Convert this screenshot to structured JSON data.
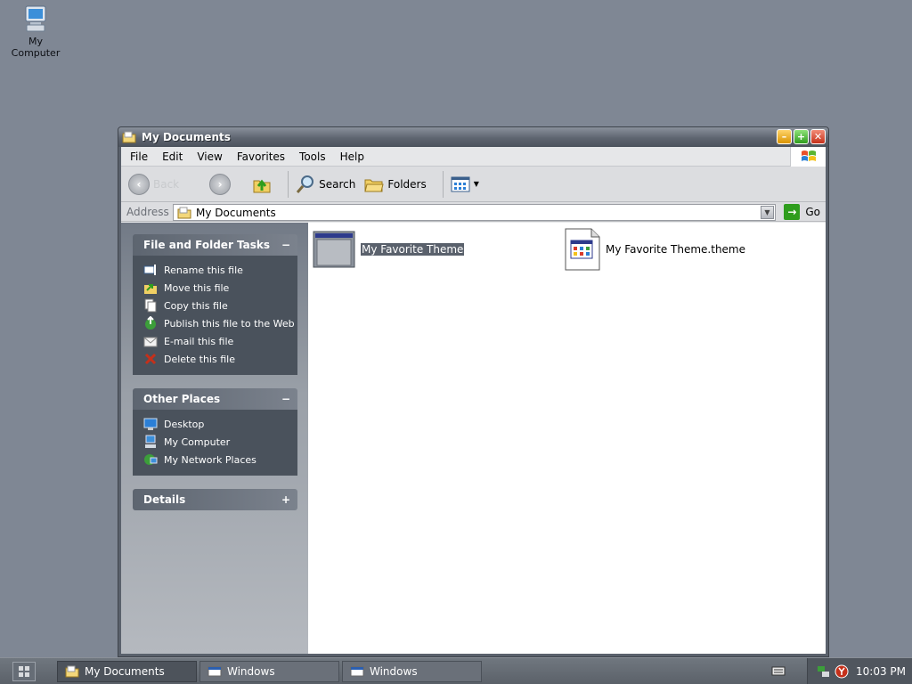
{
  "desktop": {
    "icons": [
      {
        "label": "My Computer"
      }
    ]
  },
  "window": {
    "title": "My Documents",
    "menu": [
      "File",
      "Edit",
      "View",
      "Favorites",
      "Tools",
      "Help"
    ],
    "toolbar": {
      "back_label": "Back",
      "search_label": "Search",
      "folders_label": "Folders"
    },
    "address": {
      "label": "Address",
      "value": "My Documents",
      "go_label": "Go"
    },
    "task_pane": {
      "file_tasks": {
        "title": "File and Folder Tasks",
        "toggle": "−",
        "items": [
          "Rename this file",
          "Move this file",
          "Copy this file",
          "Publish this file to the Web",
          "E-mail this file",
          "Delete this file"
        ]
      },
      "other_places": {
        "title": "Other Places",
        "toggle": "−",
        "items": [
          "Desktop",
          "My Computer",
          "My Network Places"
        ]
      },
      "details": {
        "title": "Details",
        "toggle": "+"
      }
    },
    "files": [
      {
        "name": "My Favorite Theme",
        "selected": true
      },
      {
        "name": "My Favorite Theme.theme",
        "selected": false
      }
    ]
  },
  "taskbar": {
    "buttons": [
      {
        "label": "My Documents",
        "active": true
      },
      {
        "label": "Windows",
        "active": false
      },
      {
        "label": "Windows",
        "active": false
      }
    ],
    "clock": "10:03 PM"
  },
  "colors": {
    "desktop_bg": "#7f8794",
    "title_bar": "#5e6570",
    "selection": "#5a616c"
  }
}
